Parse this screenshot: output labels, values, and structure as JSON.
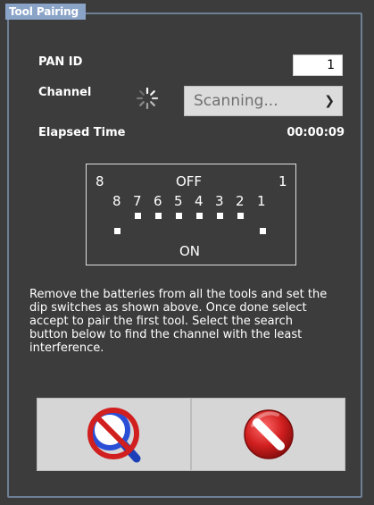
{
  "panel": {
    "title": "Tool Pairing"
  },
  "form": {
    "pan_id_label": "PAN ID",
    "pan_id_value": "1",
    "channel_label": "Channel",
    "channel_selected": "Scanning...",
    "elapsed_label": "Elapsed Time",
    "elapsed_value": "00:00:09"
  },
  "dip": {
    "left_number": "8",
    "off_label": "OFF",
    "right_number": "1",
    "switch_numbers": [
      "8",
      "7",
      "6",
      "5",
      "4",
      "3",
      "2",
      "1"
    ],
    "on_label": "ON"
  },
  "instructions": "Remove the batteries from all the tools and set the dip switches as shown above. Once done select accept to pair the first tool. Select the search button below to find the channel with the least interference.",
  "buttons": {
    "search_icon": "search-magnifier-icon",
    "cancel_icon": "cancel-no-icon"
  },
  "colors": {
    "background": "#3c3c3c",
    "legend": "#8aa4c8",
    "button": "#d6d6d6",
    "accent_blue": "#2a4fd6",
    "accent_red": "#d11f1f"
  }
}
